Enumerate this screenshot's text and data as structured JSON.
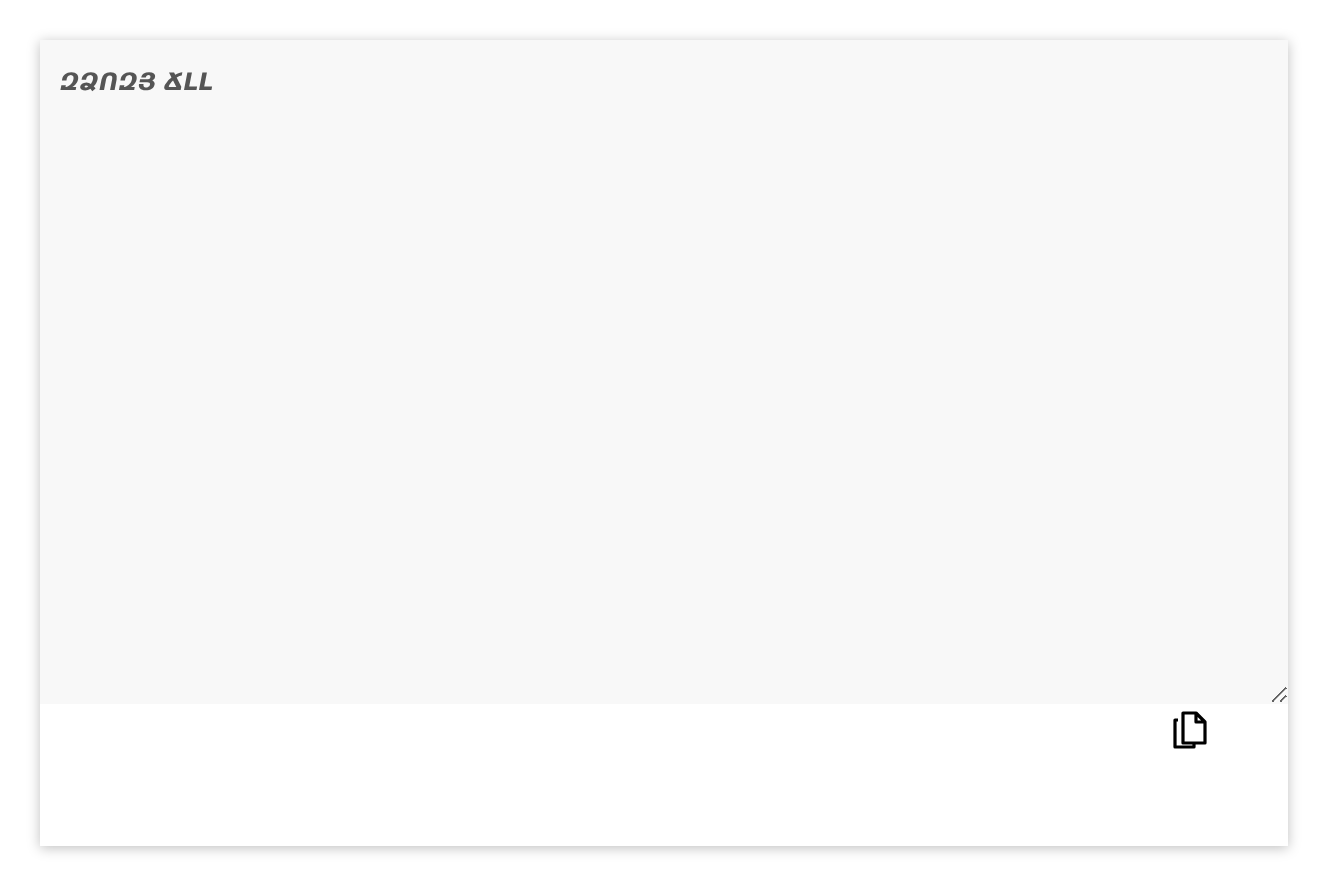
{
  "editor": {
    "placeholder": "ԶՁՈԶՅ ՃԼԼ"
  }
}
